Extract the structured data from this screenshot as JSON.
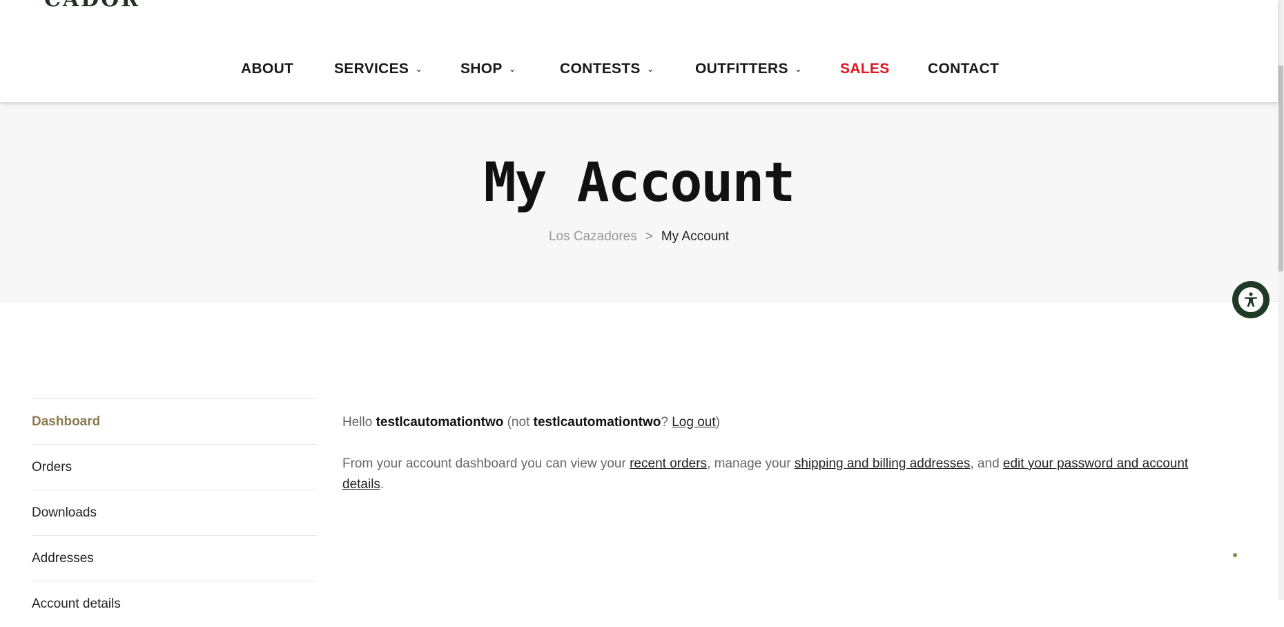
{
  "header": {
    "logo_text": "CADOR",
    "nav": [
      {
        "label": "ABOUT",
        "dropdown": false
      },
      {
        "label": "SERVICES",
        "dropdown": true
      },
      {
        "label": "SHOP",
        "dropdown": true
      },
      {
        "label": "CONTESTS",
        "dropdown": true
      },
      {
        "label": "OUTFITTERS",
        "dropdown": true
      },
      {
        "label": "SALES",
        "dropdown": false,
        "color": "#e3151e"
      },
      {
        "label": "CONTACT",
        "dropdown": false
      }
    ],
    "chevron_icon": "chevron-down-icon",
    "chevron_glyph": "⌄"
  },
  "banner": {
    "title": "My Account",
    "breadcrumb": {
      "home": "Los Cazadores",
      "separator": ">",
      "current": "My Account"
    }
  },
  "sidebar": {
    "items": [
      {
        "label": "Dashboard",
        "active": true
      },
      {
        "label": "Orders"
      },
      {
        "label": "Downloads"
      },
      {
        "label": "Addresses"
      },
      {
        "label": "Account details"
      }
    ]
  },
  "dashboard": {
    "hello": "Hello",
    "username": "testlcautomationtwo",
    "not_prefix": "(not",
    "username2": "testlcautomationtwo",
    "question": "?",
    "logout": "Log out",
    "close_paren": ")",
    "text1": "From your account dashboard you can view your",
    "link_orders": "recent orders",
    "text2": ", manage your",
    "link_addresses": "shipping and billing addresses",
    "text3": ", and",
    "link_account": "edit your password and account details",
    "text4": "."
  },
  "accessibility": {
    "icon": "accessibility-icon"
  },
  "colors": {
    "accent": "#8c7a4f",
    "sales": "#e3151e",
    "brand_green": "#1f3a25"
  }
}
